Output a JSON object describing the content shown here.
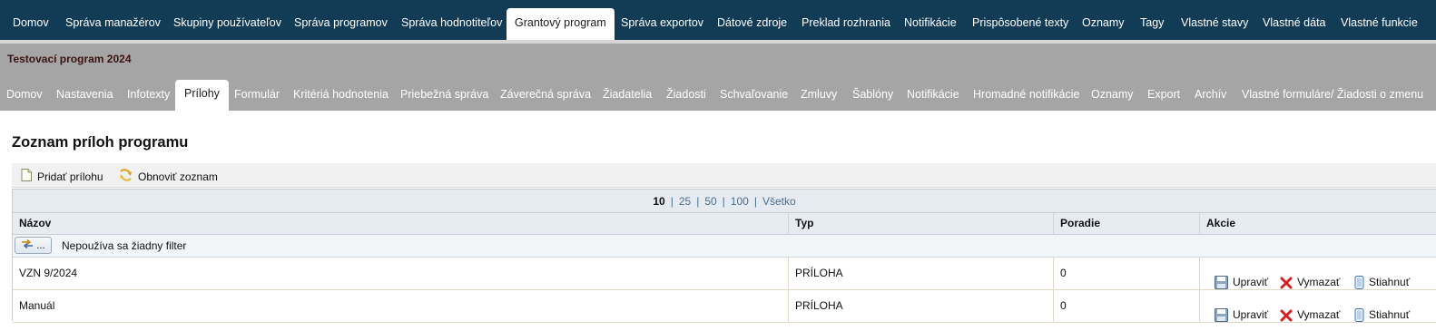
{
  "top_nav": {
    "tabs": [
      {
        "label": "Domov"
      },
      {
        "label": "Správa manažérov"
      },
      {
        "label": "Skupiny používateľov"
      },
      {
        "label": "Správa programov"
      },
      {
        "label": "Správa hodnotiteľov"
      },
      {
        "label": "Grantový program",
        "active": true
      },
      {
        "label": "Správa exportov"
      },
      {
        "label": "Dátové zdroje"
      },
      {
        "label": "Preklad rozhrania"
      },
      {
        "label": "Notifikácie"
      },
      {
        "label": "Prispôsobené texty"
      },
      {
        "label": "Oznamy"
      },
      {
        "label": "Tagy"
      },
      {
        "label": "Vlastné stavy"
      },
      {
        "label": "Vlastné dáta"
      },
      {
        "label": "Vlastné funkcie"
      }
    ]
  },
  "program": {
    "title": "Testovací program 2024"
  },
  "sub_nav": {
    "tabs": [
      {
        "label": "Domov"
      },
      {
        "label": "Nastavenia"
      },
      {
        "label": "Infotexty"
      },
      {
        "label": "Prílohy",
        "active": true
      },
      {
        "label": "Formulár"
      },
      {
        "label": "Kritériá hodnotenia"
      },
      {
        "label": "Priebežná správa"
      },
      {
        "label": "Záverečná správa"
      },
      {
        "label": "Žiadatelia"
      },
      {
        "label": "Žiadosti"
      },
      {
        "label": "Schvaľovanie"
      },
      {
        "label": "Zmluvy"
      },
      {
        "label": "Šablóny"
      },
      {
        "label": "Notifikácie"
      },
      {
        "label": "Hromadné notifikácie"
      },
      {
        "label": "Oznamy"
      },
      {
        "label": "Export"
      },
      {
        "label": "Archív"
      },
      {
        "label": "Vlastné formuláre/ Žiadosti o zmenu"
      }
    ]
  },
  "page": {
    "title": "Zoznam príloh programu"
  },
  "toolbar": {
    "add_label": "Pridať prílohu",
    "refresh_label": "Obnoviť zoznam"
  },
  "pager": {
    "sizes": [
      "10",
      "25",
      "50",
      "100",
      "Všetko"
    ],
    "current": "10"
  },
  "table": {
    "columns": [
      "Názov",
      "Typ",
      "Poradie",
      "Akcie"
    ],
    "filter_button": "...",
    "filter_text": "Nepoužíva sa žiadny filter",
    "rows": [
      {
        "name": "VZN 9/2024",
        "type": "PRÍLOHA",
        "order": "0"
      },
      {
        "name": "Manuál",
        "type": "PRÍLOHA",
        "order": "0"
      }
    ],
    "actions": {
      "edit": "Upraviť",
      "delete": "Vymazať",
      "download": "Stiahnuť"
    }
  },
  "colors": {
    "top_nav_bg": "#123b56",
    "sub_nav_bg": "#a5a5a5",
    "program_title": "#3b1212",
    "delete_icon": "#d42020"
  }
}
